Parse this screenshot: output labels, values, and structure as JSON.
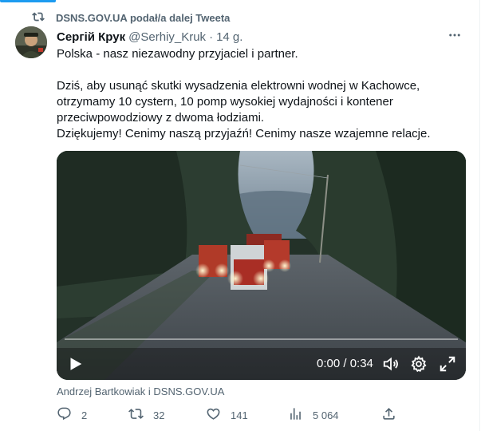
{
  "retweet_banner": {
    "text": "DSNS.GOV.UA podał/a dalej Tweeta",
    "icon": "retweet-icon"
  },
  "tweet": {
    "author_name": "Сергій Крук",
    "author_handle": "@Serhiy_Kruk",
    "separator": "·",
    "time": "14 g.",
    "more_icon": "more-dots-icon",
    "text_lines": [
      "Polska - nasz niezawodny przyjaciel i partner.",
      "Dziś, aby usunąć skutki wysadzenia elektrowni wodnej w Kachowce, otrzymamy 10 cystern, 10 pomp wysokiej wydajności i kontener przeciwpowodziowy z dwoma łodziami.",
      "Dziękujemy! Cenimy naszą przyjaźń! Cenimy nasze wzajemne relacje."
    ]
  },
  "video": {
    "time_display": "0:00 / 0:34",
    "progress_fraction": 0,
    "controls": [
      "play-icon",
      "volume-icon",
      "settings-gear-icon",
      "fullscreen-icon"
    ]
  },
  "media_source": "Andrzej Bartkowiak i DSNS.GOV.UA",
  "actions": {
    "reply_count": "2",
    "retweet_count": "32",
    "like_count": "141",
    "views_count": "5 064"
  },
  "colors": {
    "accent": "#1d9bf0",
    "muted_text": "#536471",
    "primary_text": "#0f1419"
  }
}
